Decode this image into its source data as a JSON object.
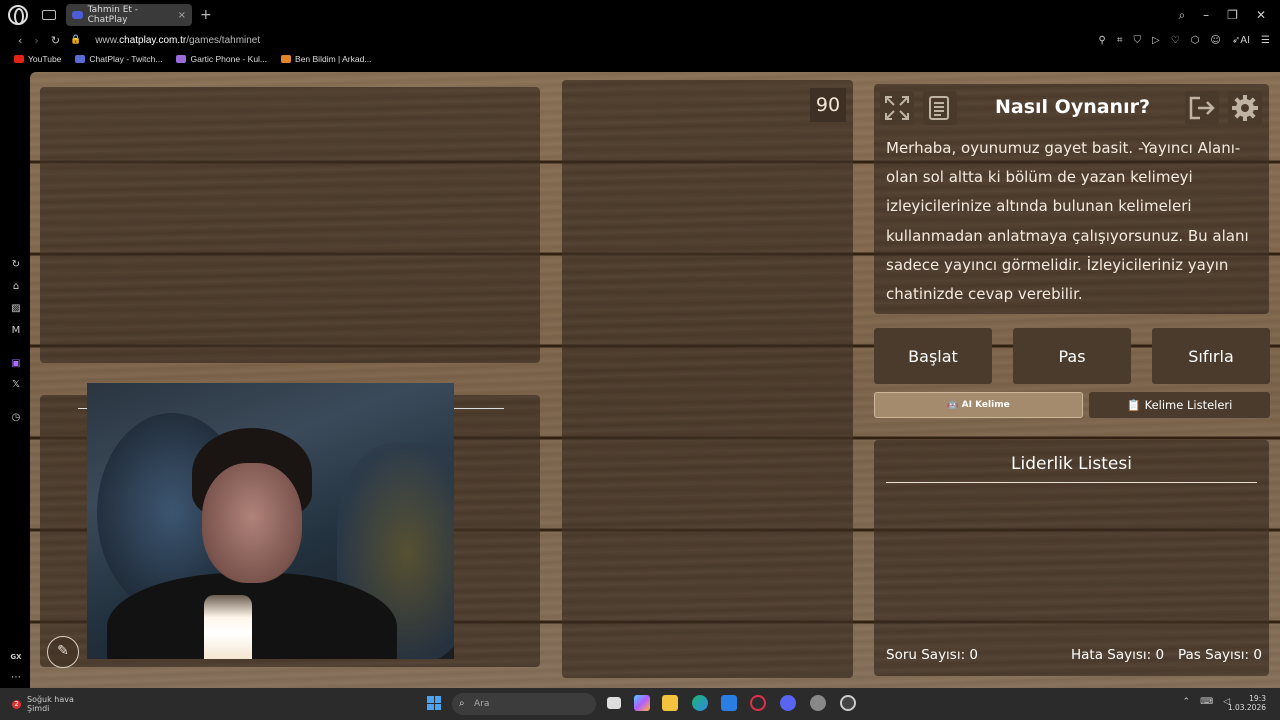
{
  "browser": {
    "tab_title": "Tahmin Et - ChatPlay",
    "tab_close": "×",
    "new_tab": "+",
    "url_prefix": "www.",
    "url_host": "chatplay.com.tr",
    "url_path": "/games/tahminet",
    "bookmarks": [
      {
        "label": "YouTube",
        "color": "#e62117"
      },
      {
        "label": "ChatPlay - Twitch...",
        "color": "#5a6bd6"
      },
      {
        "label": "Gartic Phone - Kul...",
        "color": "#9a6bd8"
      },
      {
        "label": "Ben Bildim | Arkad...",
        "color": "#e2842a"
      }
    ],
    "ai_label": "AI"
  },
  "game": {
    "timer": "90",
    "how_title": "Nasıl Oynanır?",
    "how_text": "Merhaba, oyunumuz gayet basit. -Yayıncı Alanı- olan sol altta ki bölüm de yazan kelimeyi izleyicilerinize altında bulunan kelimeleri kullanmadan anlatmaya çalışıyorsunuz. Bu alanı sadece yayıncı görmelidir. İzleyicileriniz yayın chatinizde cevap verebilir.",
    "buttons": {
      "start": "Başlat",
      "pass": "Pas",
      "reset": "Sıfırla",
      "ai_word": "🤖 AI Kelime",
      "word_lists": "📋 Kelime Listeleri"
    },
    "leaderboard_title": "Liderlik Listesi",
    "stats": {
      "questions": "Soru Sayısı: 0",
      "errors": "Hata Sayısı: 0",
      "passes": "Pas Sayısı: 0"
    }
  },
  "taskbar": {
    "weather_badge": "2",
    "weather_line1": "Soğuk hava",
    "weather_line2": "Şimdi",
    "search_placeholder": "Ara",
    "time": "19:3",
    "date": "1.03.2026",
    "sidebar_gx": "GX"
  }
}
